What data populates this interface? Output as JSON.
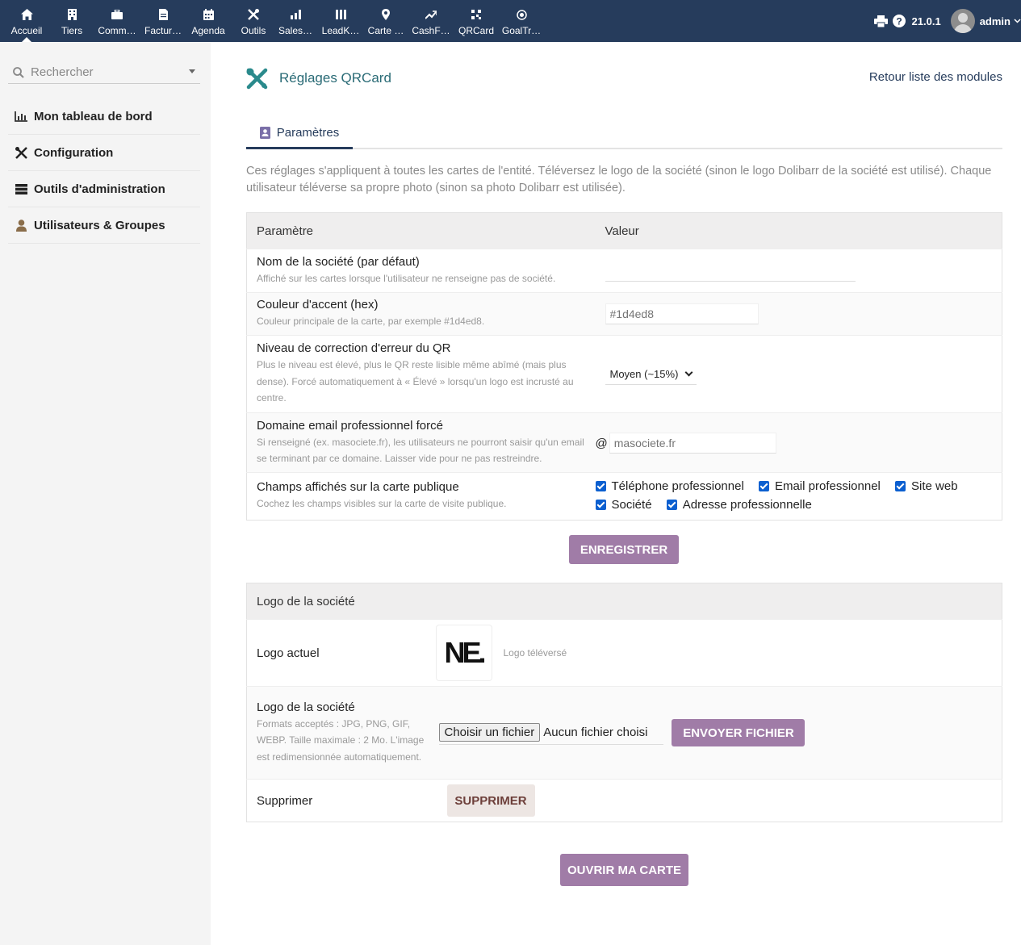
{
  "topnav": {
    "items": [
      {
        "label": "Accueil",
        "icon": "home-icon"
      },
      {
        "label": "Tiers",
        "icon": "building-icon"
      },
      {
        "label": "Comm…",
        "icon": "briefcase-icon"
      },
      {
        "label": "Factur…",
        "icon": "invoice-icon"
      },
      {
        "label": "Agenda",
        "icon": "calendar-icon"
      },
      {
        "label": "Outils",
        "icon": "tools-icon"
      },
      {
        "label": "Sales…",
        "icon": "bar-chart-icon"
      },
      {
        "label": "LeadK…",
        "icon": "columns-icon"
      },
      {
        "label": "Carte …",
        "icon": "map-pin-icon"
      },
      {
        "label": "CashF…",
        "icon": "trend-icon"
      },
      {
        "label": "QRCard",
        "icon": "qr-icon"
      },
      {
        "label": "GoalTr…",
        "icon": "target-icon"
      }
    ],
    "version": "21.0.1",
    "user": "admin"
  },
  "sidebar": {
    "search_placeholder": "Rechercher",
    "items": [
      {
        "label": "Mon tableau de bord",
        "icon": "dashboard-chart-icon"
      },
      {
        "label": "Configuration",
        "icon": "tools-icon"
      },
      {
        "label": "Outils d'administration",
        "icon": "server-icon"
      },
      {
        "label": "Utilisateurs & Groupes",
        "icon": "user-icon"
      }
    ]
  },
  "page": {
    "title": "Réglages QRCard",
    "back_link": "Retour liste des modules",
    "tab": "Paramètres",
    "description": "Ces réglages s'appliquent à toutes les cartes de l'entité. Téléversez le logo de la société (sinon le logo Dolibarr de la société est utilisé). Chaque utilisateur téléverse sa propre photo (sinon sa photo Dolibarr est utilisée).",
    "accent_color": "#a07ca7"
  },
  "settings": {
    "col_param": "Paramètre",
    "col_value": "Valeur",
    "company_name": {
      "label": "Nom de la société (par défaut)",
      "hint": "Affiché sur les cartes lorsque l'utilisateur ne renseigne pas de société.",
      "value": ""
    },
    "accent": {
      "label": "Couleur d'accent (hex)",
      "hint": "Couleur principale de la carte, par exemple #1d4ed8.",
      "placeholder": "#1d4ed8"
    },
    "ecc": {
      "label": "Niveau de correction d'erreur du QR",
      "hint": "Plus le niveau est élevé, plus le QR reste lisible même abîmé (mais plus dense). Forcé automatiquement à « Élevé » lorsqu'un logo est incrusté au centre.",
      "selected": "Moyen (~15%)"
    },
    "domain": {
      "label": "Domaine email professionnel forcé",
      "hint": "Si renseigné (ex. masociete.fr), les utilisateurs ne pourront saisir qu'un email se terminant par ce domaine. Laisser vide pour ne pas restreindre.",
      "prefix": "@",
      "placeholder": "masociete.fr"
    },
    "fields": {
      "label": "Champs affichés sur la carte publique",
      "hint": "Cochez les champs visibles sur la carte de visite publique.",
      "options": [
        {
          "label": "Téléphone professionnel",
          "checked": true
        },
        {
          "label": "Email professionnel",
          "checked": true
        },
        {
          "label": "Site web",
          "checked": true
        },
        {
          "label": "Société",
          "checked": true
        },
        {
          "label": "Adresse professionnelle",
          "checked": true
        }
      ]
    },
    "save_button": "ENREGISTRER"
  },
  "logo": {
    "section_title": "Logo de la société",
    "current_label": "Logo actuel",
    "current_logo_text": "NE.",
    "uploaded_caption": "Logo téléversé",
    "upload_label": "Logo de la société",
    "upload_hint": "Formats acceptés : JPG, PNG, GIF, WEBP. Taille maximale : 2 Mo. L'image est redimensionnée automatiquement.",
    "choose_file": "Choisir un fichier",
    "no_file": "Aucun fichier choisi",
    "send_button": "ENVOYER FICHIER",
    "delete_label": "Supprimer",
    "delete_button": "SUPPRIMER"
  },
  "open_card_button": "OUVRIR MA CARTE"
}
